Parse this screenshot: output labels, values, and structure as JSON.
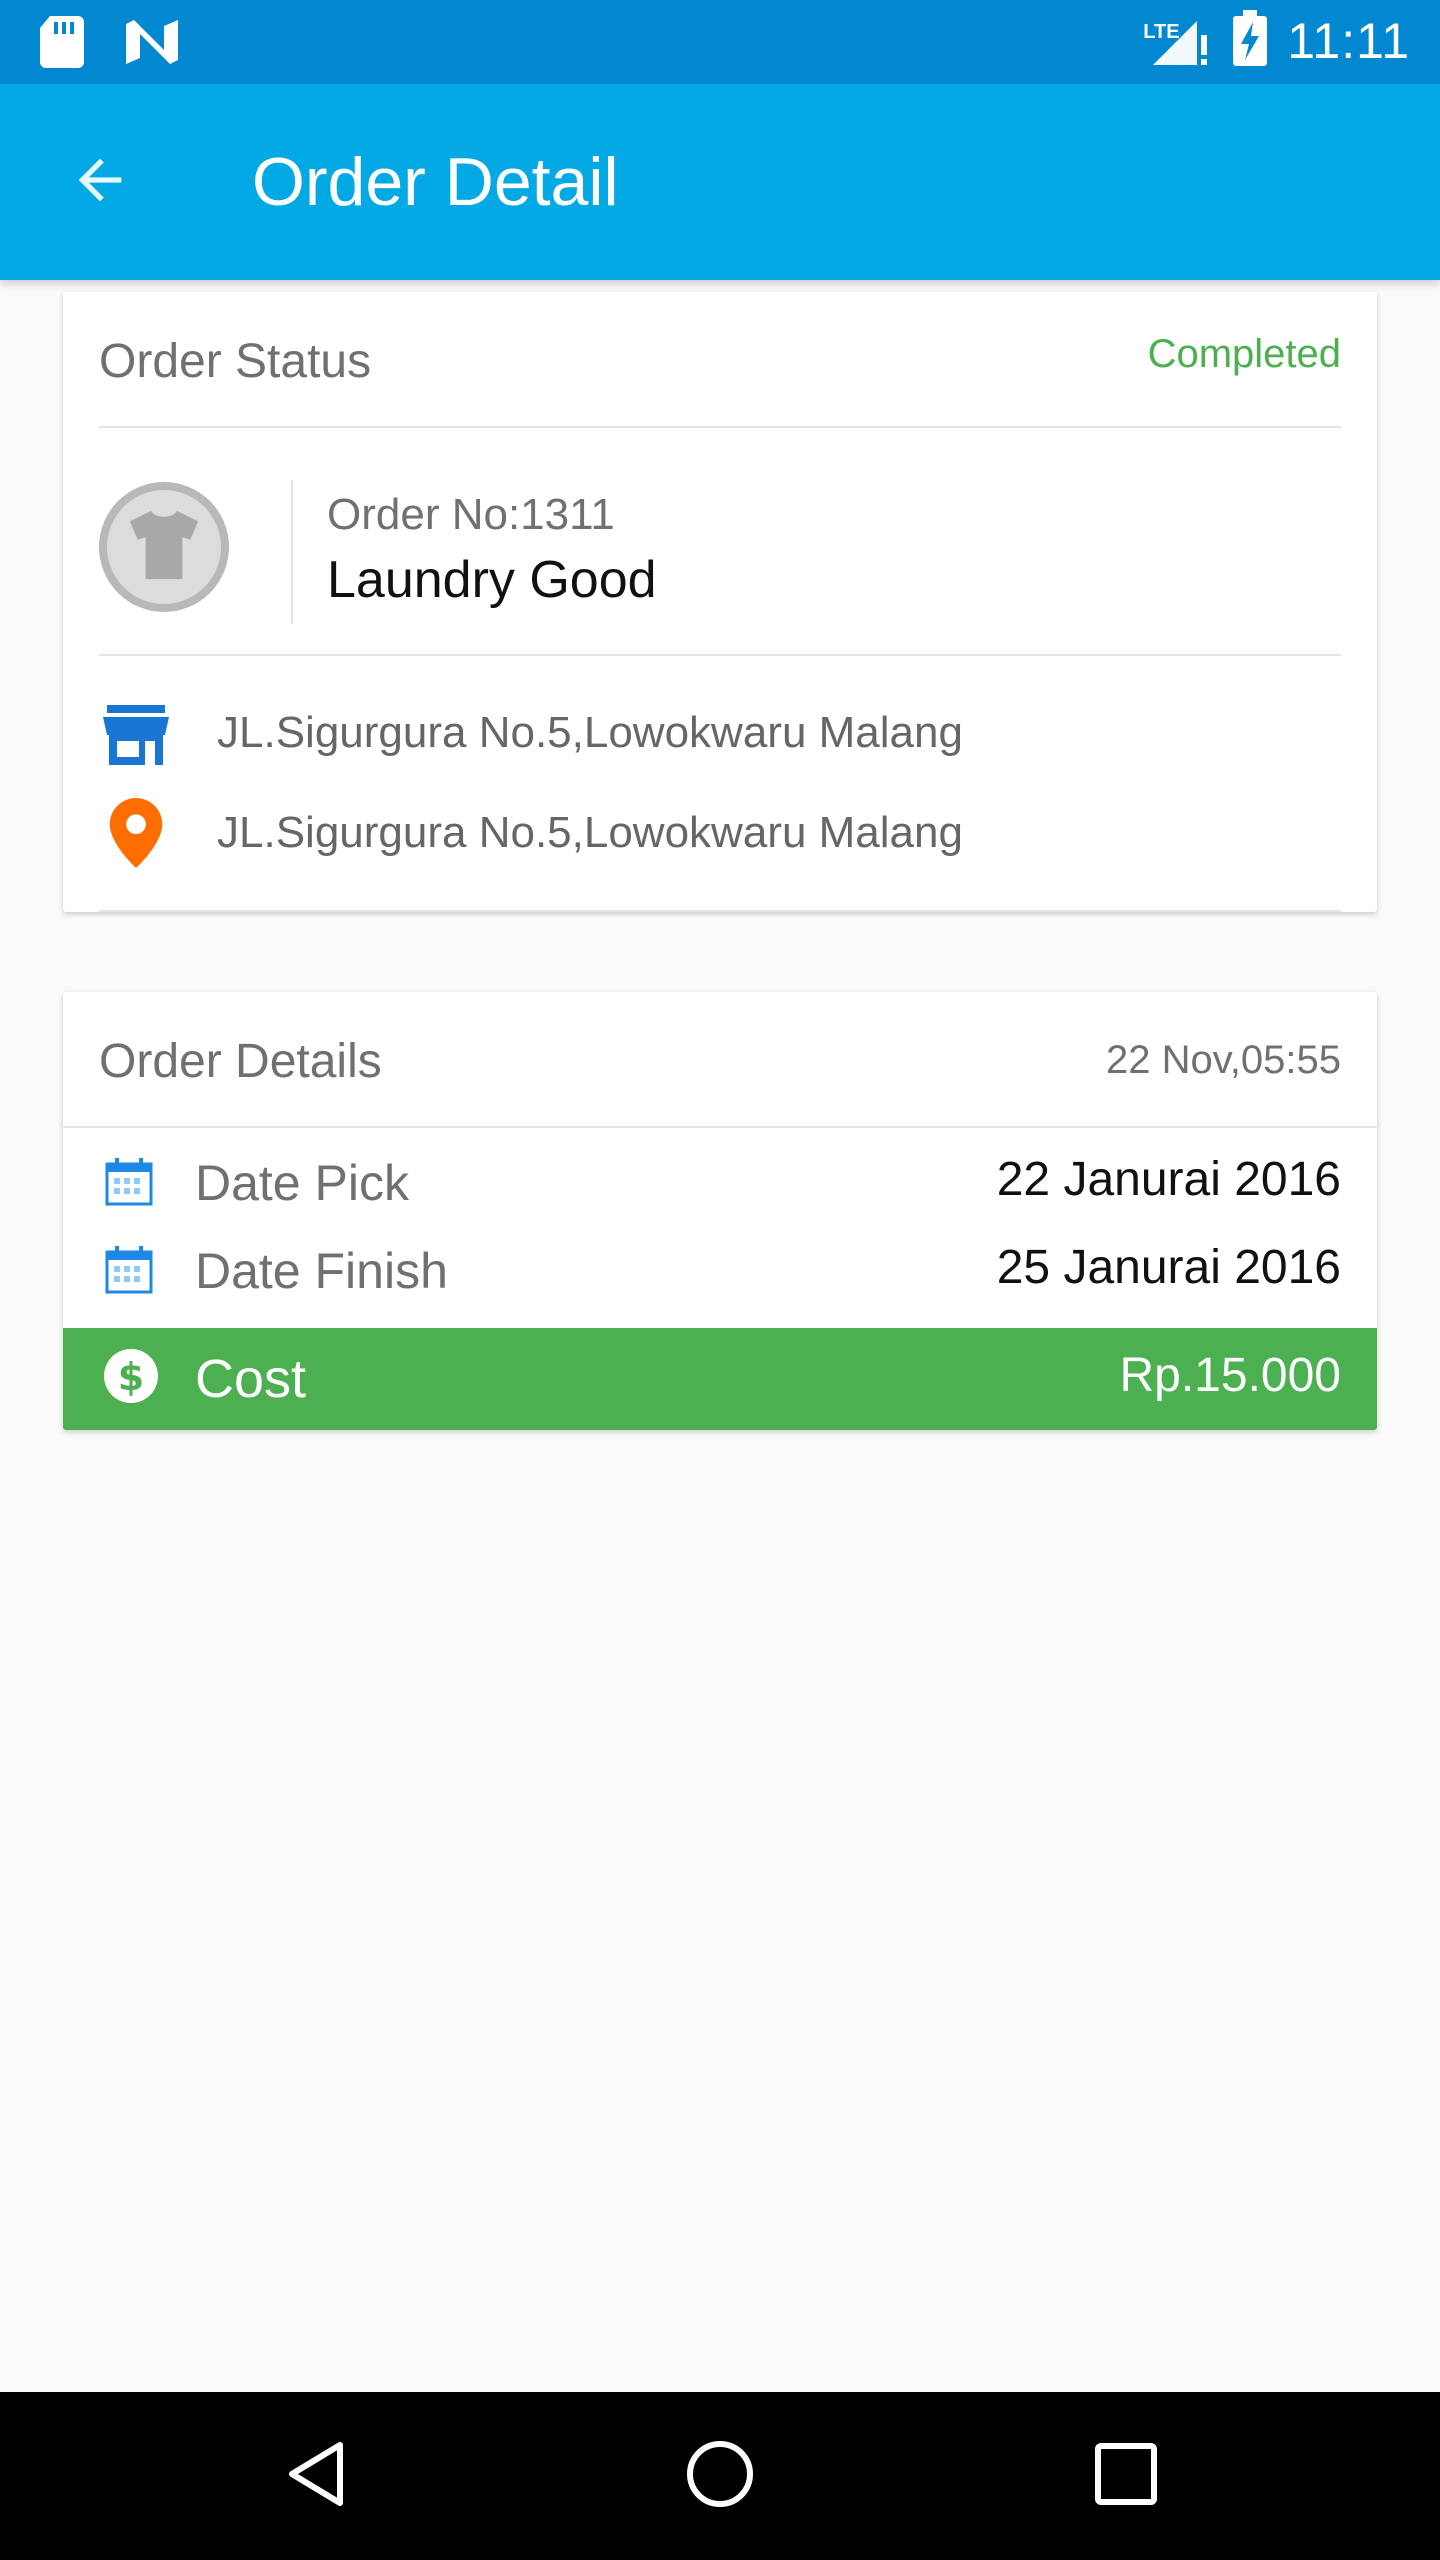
{
  "status_bar": {
    "time": "11:11",
    "network": "LTE",
    "icons": [
      "sd-card-icon",
      "n-logo-icon",
      "signal-icon",
      "battery-icon"
    ]
  },
  "app_bar": {
    "title": "Order Detail",
    "back_icon": "arrow-back-icon"
  },
  "order_status_card": {
    "label": "Order Status",
    "status": "Completed",
    "order_no": "Order No:1311",
    "item_name": "Laundry Good",
    "avatar_icon": "t-shirt-icon",
    "shop_address": "JL.Sigurgura No.5,Lowokwaru Malang",
    "shop_icon": "store-icon",
    "delivery_address": "JL.Sigurgura No.5,Lowokwaru Malang",
    "delivery_icon": "location-pin-icon"
  },
  "order_details_card": {
    "label": "Order Details",
    "date": "22 Nov,05:55",
    "rows": [
      {
        "label": "Date Pick",
        "value": "22 Janurai 2016",
        "icon": "calendar-icon"
      },
      {
        "label": "Date Finish",
        "value": "25 Janurai 2016",
        "icon": "calendar-icon"
      }
    ],
    "cost": {
      "label": "Cost",
      "value": "Rp.15.000",
      "icon": "dollar-circle-icon"
    }
  },
  "colors": {
    "status_bar": "#0288d1",
    "app_bar": "#03a9e4",
    "completed": "#4caf50",
    "cost_bar": "#4caf50",
    "store_icon": "#1976d2",
    "pin_icon": "#ff6d00"
  },
  "nav_bar": {
    "back": "nav-back-icon",
    "home": "nav-home-icon",
    "recents": "nav-recents-icon"
  }
}
